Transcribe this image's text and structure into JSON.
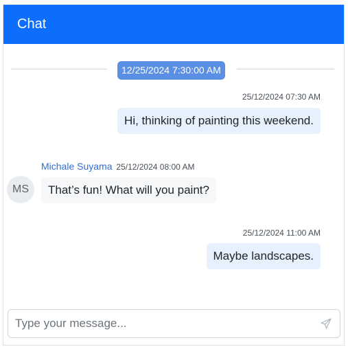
{
  "header": {
    "title": "Chat"
  },
  "date_separator": "12/25/2024 7:30:00 AM",
  "messages": [
    {
      "direction": "out",
      "timestamp": "25/12/2024 07:30 AM",
      "text": "Hi, thinking of painting this weekend."
    },
    {
      "direction": "in",
      "sender": "Michale Suyama",
      "avatar_initials": "MS",
      "timestamp": "25/12/2024 08:00 AM",
      "text": "That’s fun! What will you paint?"
    },
    {
      "direction": "out",
      "timestamp": "25/12/2024 11:00 AM",
      "text": "Maybe landscapes."
    }
  ],
  "composer": {
    "placeholder": "Type your message...",
    "value": "",
    "send_icon": "send-icon"
  },
  "colors": {
    "header": "#0d6efd",
    "date_chip": "#5b8fe3",
    "outgoing_bubble": "#e7f1fd",
    "incoming_bubble": "#f6f7f8",
    "sender_name": "#2e6fd6"
  }
}
